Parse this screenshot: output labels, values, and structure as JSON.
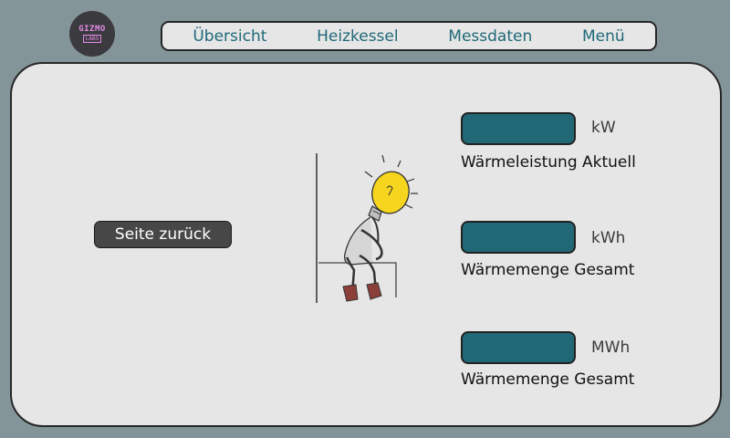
{
  "logo": {
    "line1": "GIZMO",
    "line2": "LABS"
  },
  "nav": {
    "items": [
      "Übersicht",
      "Heizkessel",
      "Messdaten",
      "Menü"
    ]
  },
  "back_button": {
    "label": "Seite zurück"
  },
  "illustration": {
    "icon": "thinking-lightbulb-figure"
  },
  "readings": [
    {
      "value": "",
      "unit": "kW",
      "label": "Wärmeleistung Aktuell"
    },
    {
      "value": "",
      "unit": "kWh",
      "label": "Wärmemenge Gesamt"
    },
    {
      "value": "",
      "unit": "MWh",
      "label": "Wärmemenge Gesamt"
    }
  ],
  "colors": {
    "background": "#84959a",
    "panel": "#e6e6e6",
    "accent": "#216877",
    "button": "#474747"
  }
}
